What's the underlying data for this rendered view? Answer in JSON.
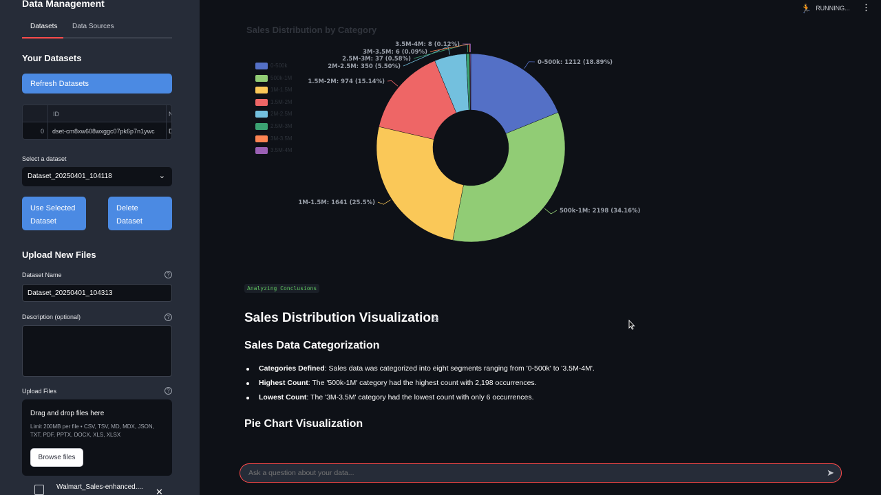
{
  "sidebar": {
    "title": "Data Management",
    "tabs": [
      {
        "label": "Datasets"
      },
      {
        "label": "Data Sources"
      }
    ],
    "your_datasets": "Your Datasets",
    "refresh_label": "Refresh Datasets",
    "table": {
      "columns": [
        "ID",
        "N"
      ],
      "rows": [
        {
          "index": "0",
          "id": "dset-cm8xw608wxggc07pk6p7n1ywc",
          "n": "D"
        }
      ]
    },
    "select_label": "Select a dataset",
    "select_value": "Dataset_20250401_104118",
    "use_selected_label": "Use Selected Dataset",
    "delete_label": "Delete Dataset",
    "upload_heading": "Upload New Files",
    "dataset_name_label": "Dataset Name",
    "dataset_name_value": "Dataset_20250401_104313",
    "description_label": "Description (optional)",
    "upload_files_label": "Upload Files",
    "dropzone_title": "Drag and drop files here",
    "dropzone_limit": "Limit 200MB per file • CSV, TSV, MD, MDX, JSON, TXT, PDF, PPTX, DOCX, XLS, XLSX",
    "browse_label": "Browse files",
    "file_name": "Walmart_Sales-enhanced...."
  },
  "header": {
    "status": "RUNNING...",
    "runner_icon": "running-figure-icon",
    "menu_icon": "kebab-menu-icon"
  },
  "chart_data": {
    "type": "pie",
    "title": "Sales Distribution by Category",
    "categories": [
      "0-500k",
      "500k-1M",
      "1M-1.5M",
      "1.5M-2M",
      "2M-2.5M",
      "2.5M-3M",
      "3M-3.5M",
      "3.5M-4M"
    ],
    "values": [
      1212,
      2198,
      1641,
      974,
      350,
      37,
      6,
      8
    ],
    "percent_labels": [
      "18.89%",
      "34.16%",
      "25.5%",
      "15.14%",
      "5.50%",
      "0.58%",
      "0.09%",
      "0.12%"
    ],
    "slice_labels": [
      "0-500k: 1212 (18.89%)",
      "500k-1M: 2198 (34.16%)",
      "1M-1.5M: 1641 (25.5%)",
      "1.5M-2M: 974 (15.14%)",
      "2M-2.5M: 350 (5.50%)",
      "2.5M-3M: 37 (0.58%)",
      "3M-3.5M: 6 (0.09%)",
      "3.5M-4M: 8 (0.12%)"
    ],
    "colors": [
      "#5470c6",
      "#91cc75",
      "#fac858",
      "#ee6666",
      "#73c0de",
      "#3ba272",
      "#fc8452",
      "#9a60b4"
    ],
    "legend": "left",
    "donut": true
  },
  "main": {
    "badge": "Analyzing Conclusions",
    "title": "Sales Distribution Visualization",
    "section1": "Sales Data Categorization",
    "bullets": [
      {
        "bold": "Categories Defined",
        "text": ": Sales data was categorized into eight segments ranging from '0-500k' to '3.5M-4M'."
      },
      {
        "bold": "Highest Count",
        "text": ": The '500k-1M' category had the highest count with 2,198 occurrences."
      },
      {
        "bold": "Lowest Count",
        "text": ": The '3M-3.5M' category had the lowest count with only 6 occurrences."
      }
    ],
    "section2": "Pie Chart Visualization"
  },
  "chat": {
    "placeholder": "Ask a question about your data...",
    "send_icon": "send-icon"
  }
}
